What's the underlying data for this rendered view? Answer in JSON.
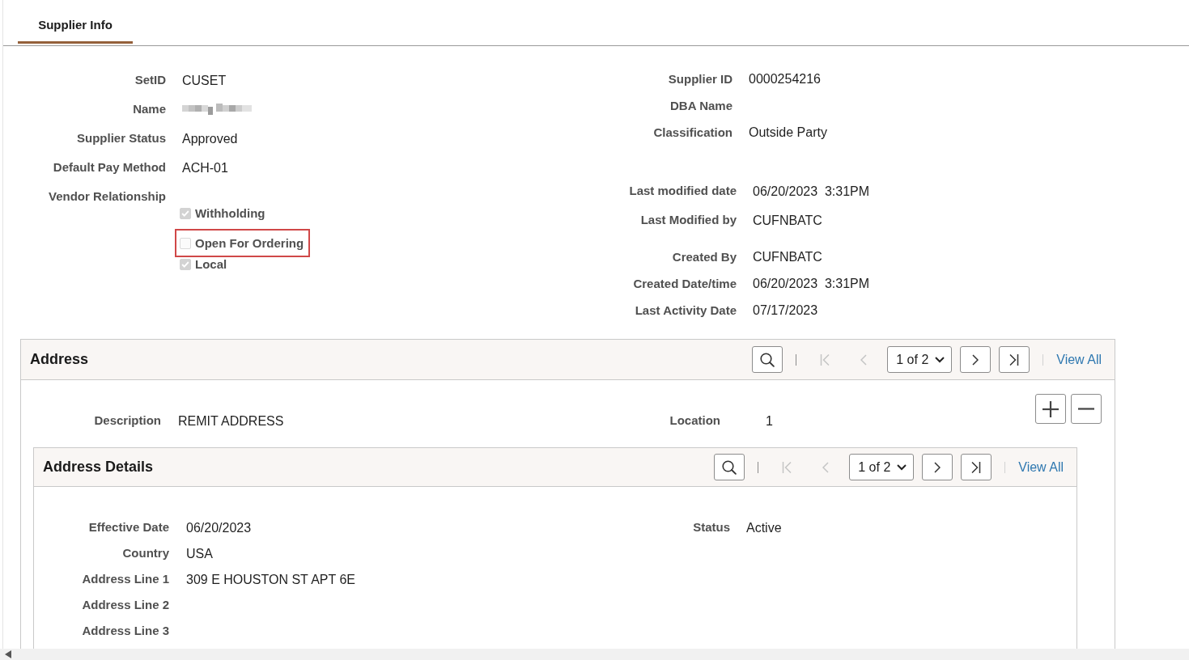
{
  "tabs": [
    {
      "label": "Supplier Info",
      "selected": true
    }
  ],
  "supplier": {
    "left_fields": [
      {
        "label": "SetID",
        "value": "CUSET"
      },
      {
        "label": "Name",
        "redacted": true
      },
      {
        "label": "Supplier Status",
        "value": "Approved"
      },
      {
        "label": "Default Pay Method",
        "value": "ACH-01"
      }
    ],
    "vendor_relationship": {
      "label": "Vendor Relationship",
      "options": [
        {
          "label": "Withholding",
          "checked": true,
          "disabled": true,
          "highlighted": false
        },
        {
          "label": "Open For Ordering",
          "checked": false,
          "disabled": true,
          "highlighted": true
        },
        {
          "label": "Local",
          "checked": true,
          "disabled": true,
          "highlighted": false
        }
      ]
    },
    "right_groups": [
      [
        {
          "label": "Supplier ID",
          "value": "0000254216"
        },
        {
          "label": "DBA Name"
        },
        {
          "label": "Classification",
          "value": "Outside Party"
        }
      ],
      [
        {
          "label": "Last modified date",
          "value": "06/20/2023  3:31PM"
        },
        {
          "label": "Last Modified by",
          "value": "CUFNBATC"
        }
      ],
      [
        {
          "label": "Created By",
          "value": "CUFNBATC"
        },
        {
          "label": "Created Date/time",
          "value": "06/20/2023  3:31PM"
        },
        {
          "label": "Last Activity Date",
          "value": "07/17/2023"
        }
      ]
    ]
  },
  "address": {
    "title": "Address",
    "pager": {
      "controls": [
        {
          "kind": "search",
          "disabled": false
        },
        {
          "kind": "first",
          "disabled": true
        },
        {
          "kind": "previous",
          "disabled": true
        },
        {
          "kind": "page_select",
          "value": "1 of 2"
        },
        {
          "kind": "next",
          "disabled": false
        },
        {
          "kind": "last",
          "disabled": false
        }
      ],
      "view_all": "View All"
    },
    "row_actions": [
      {
        "kind": "add"
      },
      {
        "kind": "delete"
      }
    ],
    "fields": [
      {
        "label": "Description",
        "value": "REMIT ADDRESS"
      },
      {
        "label": "Location",
        "value": "1"
      }
    ],
    "details": {
      "title": "Address Details",
      "pager": {
        "controls": [
          {
            "kind": "search",
            "disabled": false
          },
          {
            "kind": "first",
            "disabled": true
          },
          {
            "kind": "previous",
            "disabled": true
          },
          {
            "kind": "page_select",
            "value": "1 of 2"
          },
          {
            "kind": "next",
            "disabled": false
          },
          {
            "kind": "last",
            "disabled": false
          }
        ],
        "view_all": "View All"
      },
      "left_fields": [
        {
          "label": "Effective Date",
          "value": "06/20/2023"
        },
        {
          "label": "Country",
          "value": "USA"
        },
        {
          "label": "Address Line 1",
          "value": "309 E HOUSTON ST APT 6E"
        },
        {
          "label": "Address Line 2"
        },
        {
          "label": "Address Line 3"
        }
      ],
      "right_fields": [
        {
          "label": "Status",
          "value": "Active"
        }
      ]
    }
  }
}
